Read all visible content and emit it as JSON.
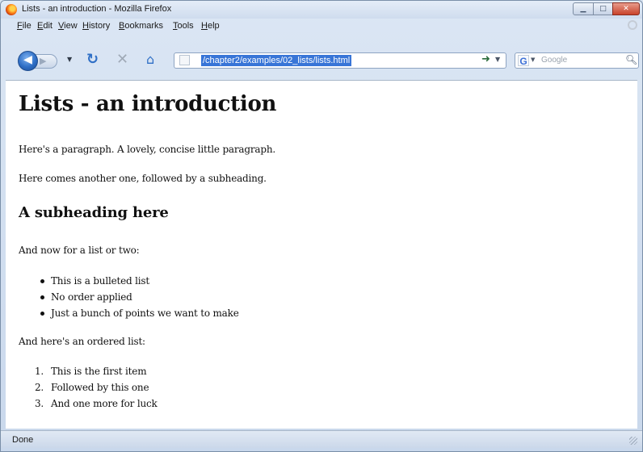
{
  "window": {
    "title": "Lists - an introduction - Mozilla Firefox"
  },
  "menubar": {
    "items": [
      "File",
      "Edit",
      "View",
      "History",
      "Bookmarks",
      "Tools",
      "Help"
    ]
  },
  "navbar": {
    "back_icon": "back-arrow-icon",
    "forward_icon": "forward-arrow-icon",
    "reload_icon": "reload-icon",
    "stop_icon": "stop-icon",
    "home_icon": "home-icon",
    "url": "/chapter2/examples/02_lists/lists.html",
    "url_selected": true,
    "search_engine": "G",
    "search_placeholder": "Google",
    "accent_color": "#3875d7"
  },
  "page": {
    "heading": "Lists - an introduction",
    "paragraph1": "Here's a paragraph. A lovely, concise little paragraph.",
    "paragraph2": "Here comes another one, followed by a subheading.",
    "subheading": "A subheading here",
    "list_intro": "And now for a list or two:",
    "bullet_items": [
      "This is a bulleted list",
      "No order applied",
      "Just a bunch of points we want to make"
    ],
    "ordered_intro": "And here's an ordered list:",
    "ordered_items": [
      "This is the first item",
      "Followed by this one",
      "And one more for luck"
    ],
    "ordered_numbers": [
      "1.",
      "2.",
      "3."
    ]
  },
  "statusbar": {
    "text": "Done"
  }
}
